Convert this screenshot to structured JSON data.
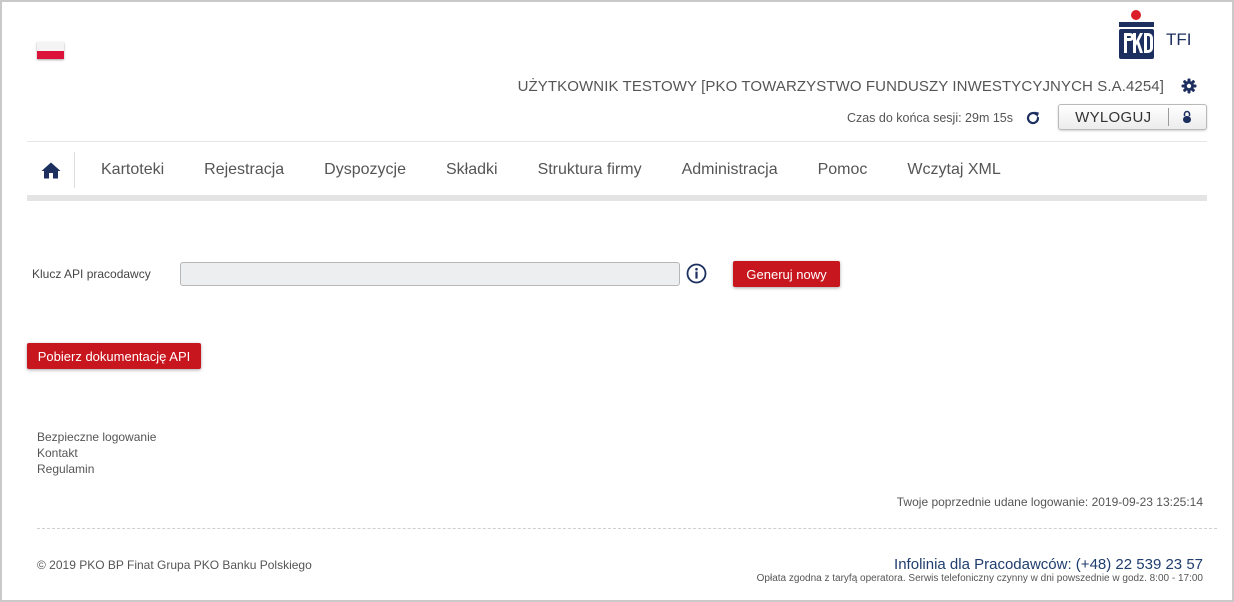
{
  "header": {
    "logo_text": "TFI",
    "user_line": "UŻYTKOWNIK TESTOWY [PKO TOWARZYSTWO FUNDUSZY INWESTYCYJNYCH S.A.4254]",
    "session_text": "Czas do końca sesji: 29m 15s",
    "logout_label": "WYLOGUJ"
  },
  "nav": {
    "items": [
      {
        "label": "Kartoteki"
      },
      {
        "label": "Rejestracja"
      },
      {
        "label": "Dyspozycje"
      },
      {
        "label": "Składki"
      },
      {
        "label": "Struktura firmy"
      },
      {
        "label": "Administracja"
      },
      {
        "label": "Pomoc"
      },
      {
        "label": "Wczytaj XML"
      }
    ]
  },
  "api": {
    "label": "Klucz API pracodawcy",
    "value": "",
    "generate_label": "Generuj nowy",
    "download_label": "Pobierz dokumentację API"
  },
  "footer": {
    "links": [
      {
        "label": "Bezpieczne logowanie"
      },
      {
        "label": "Kontakt"
      },
      {
        "label": "Regulamin"
      }
    ],
    "last_login": "Twoje poprzednie udane logowanie: 2019-09-23 13:25:14",
    "copyright": "© 2019 PKO BP Finat Grupa PKO Banku Polskiego",
    "hotline": "Infolinia dla Pracodawców: (+48) 22 539 23 57",
    "fineprint": "Opłata zgodna z taryfą operatora. Serwis telefoniczny czynny w dni powszednie w godz. 8:00 - 17:00"
  },
  "colors": {
    "brand_red": "#c8161e",
    "brand_navy": "#1c2f5f"
  }
}
